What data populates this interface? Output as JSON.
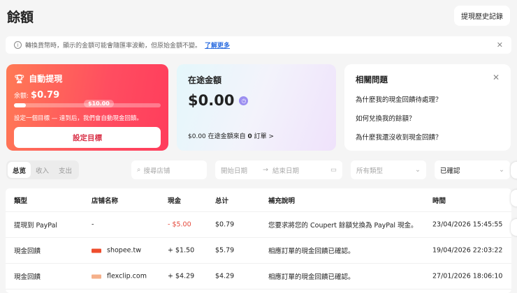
{
  "header": {
    "title": "餘額",
    "history_button": "提現歷史記錄"
  },
  "notice": {
    "text": "轉換貨幣時，顯示的金額可能會隨匯率波動，但原始金額不變。",
    "link": "了解更多"
  },
  "auto_withdraw": {
    "title": "自動提現",
    "balance_label": "余额:",
    "balance": "$0.79",
    "goal": "$10.00",
    "progress": 0.079,
    "description": "設定一個目標 — 達到后，我們會自動現金回饋。",
    "button": "設定目標"
  },
  "pending": {
    "title": "在途金額",
    "amount": "$0.00",
    "footer_prefix": "$0.00 在途金額來自",
    "footer_count": "0",
    "footer_suffix": "訂單 >"
  },
  "faq": {
    "title": "相關問題",
    "questions": [
      "為什麼我的現金回饋待處理？",
      "如何兌換我的餘額？",
      "為什麼我還沒收到現金回饋？"
    ]
  },
  "filters": {
    "tabs": [
      "总览",
      "收入",
      "支出"
    ],
    "search_placeholder": "搜尋店铺",
    "start_date": "開始日期",
    "end_date": "結束日期",
    "type_placeholder": "所有類型",
    "status": "已確認"
  },
  "table": {
    "columns": [
      "類型",
      "店铺名称",
      "現金",
      "总计",
      "補充說明",
      "時間"
    ],
    "rows": [
      {
        "type": "提現到 PayPal",
        "store": "-",
        "cash": "- $5.00",
        "total": "$0.79",
        "note": "您要求將您的 Coupert 餘額兌換為 PayPal 現金。",
        "time": "23/04/2026 15:45:55"
      },
      {
        "type": "現金回饋",
        "store": "shopee.tw",
        "cash": "+ $1.50",
        "total": "$5.79",
        "note": "相應訂單的現金回饋已確認。",
        "time": "19/04/2026 22:03:22"
      },
      {
        "type": "現金回饋",
        "store": "flexclip.com",
        "cash": "+ $4.29",
        "total": "$4.29",
        "note": "相應訂單的現金回饋已確認。",
        "time": "27/01/2026 18:06:10"
      }
    ]
  },
  "colors": {
    "negative": "#e5483a",
    "link": "#2f6fe0",
    "accent": "#ff4d60"
  }
}
